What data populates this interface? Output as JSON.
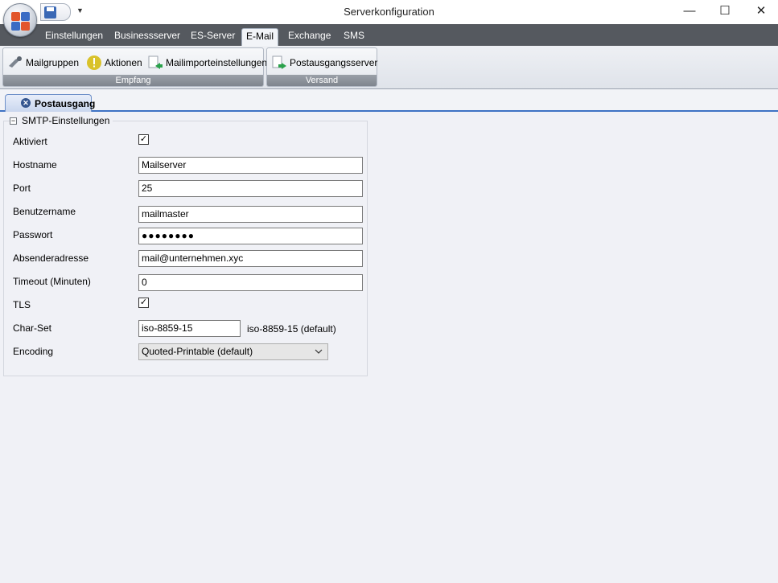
{
  "window": {
    "title": "Serverkonfiguration",
    "minimize": "—",
    "maximize": "☐",
    "close": "✕"
  },
  "menu_tabs": [
    "Einstellungen",
    "Businessserver",
    "ES-Server",
    "E-Mail",
    "Exchange",
    "SMS"
  ],
  "active_tab": "E-Mail",
  "ribbon": {
    "groups": [
      {
        "label": "Empfang",
        "buttons": [
          "Mailgruppen",
          "Aktionen",
          "Mailimporteinstellungen"
        ]
      },
      {
        "label": "Versand",
        "buttons": [
          "Postausgangsserver"
        ]
      }
    ]
  },
  "doc_tab": {
    "label": "Postausgang"
  },
  "section": {
    "title": "SMTP-Einstellungen",
    "collapse_glyph": "−",
    "fields": {
      "aktiviert": {
        "label": "Aktiviert",
        "checked": true
      },
      "hostname": {
        "label": "Hostname",
        "value": "Mailserver"
      },
      "port": {
        "label": "Port",
        "value": "25"
      },
      "benutzername": {
        "label": "Benutzername",
        "value": "mailmaster"
      },
      "passwort": {
        "label": "Passwort",
        "value": "●●●●●●●●"
      },
      "absenderadresse": {
        "label": "Absenderadresse",
        "value": "mail@unternehmen.xyc"
      },
      "timeout": {
        "label": "Timeout (Minuten)",
        "value": "0"
      },
      "tls": {
        "label": "TLS",
        "checked": true
      },
      "charset": {
        "label": "Char-Set",
        "value": "iso-8859-15",
        "default_hint": "iso-8859-15 (default)"
      },
      "encoding": {
        "label": "Encoding",
        "value": "Quoted-Printable (default)"
      }
    },
    "check_glyph": "✓"
  },
  "colors": {
    "tabbar": "#55595f",
    "accent": "#3e72c4"
  },
  "icons": [
    "app-orb-icon",
    "save-icon",
    "customize-icon",
    "mailgruppen-icon",
    "aktionen-icon",
    "mailimport-icon",
    "postausgang-icon",
    "close-tab-icon",
    "chevron-down-icon"
  ]
}
